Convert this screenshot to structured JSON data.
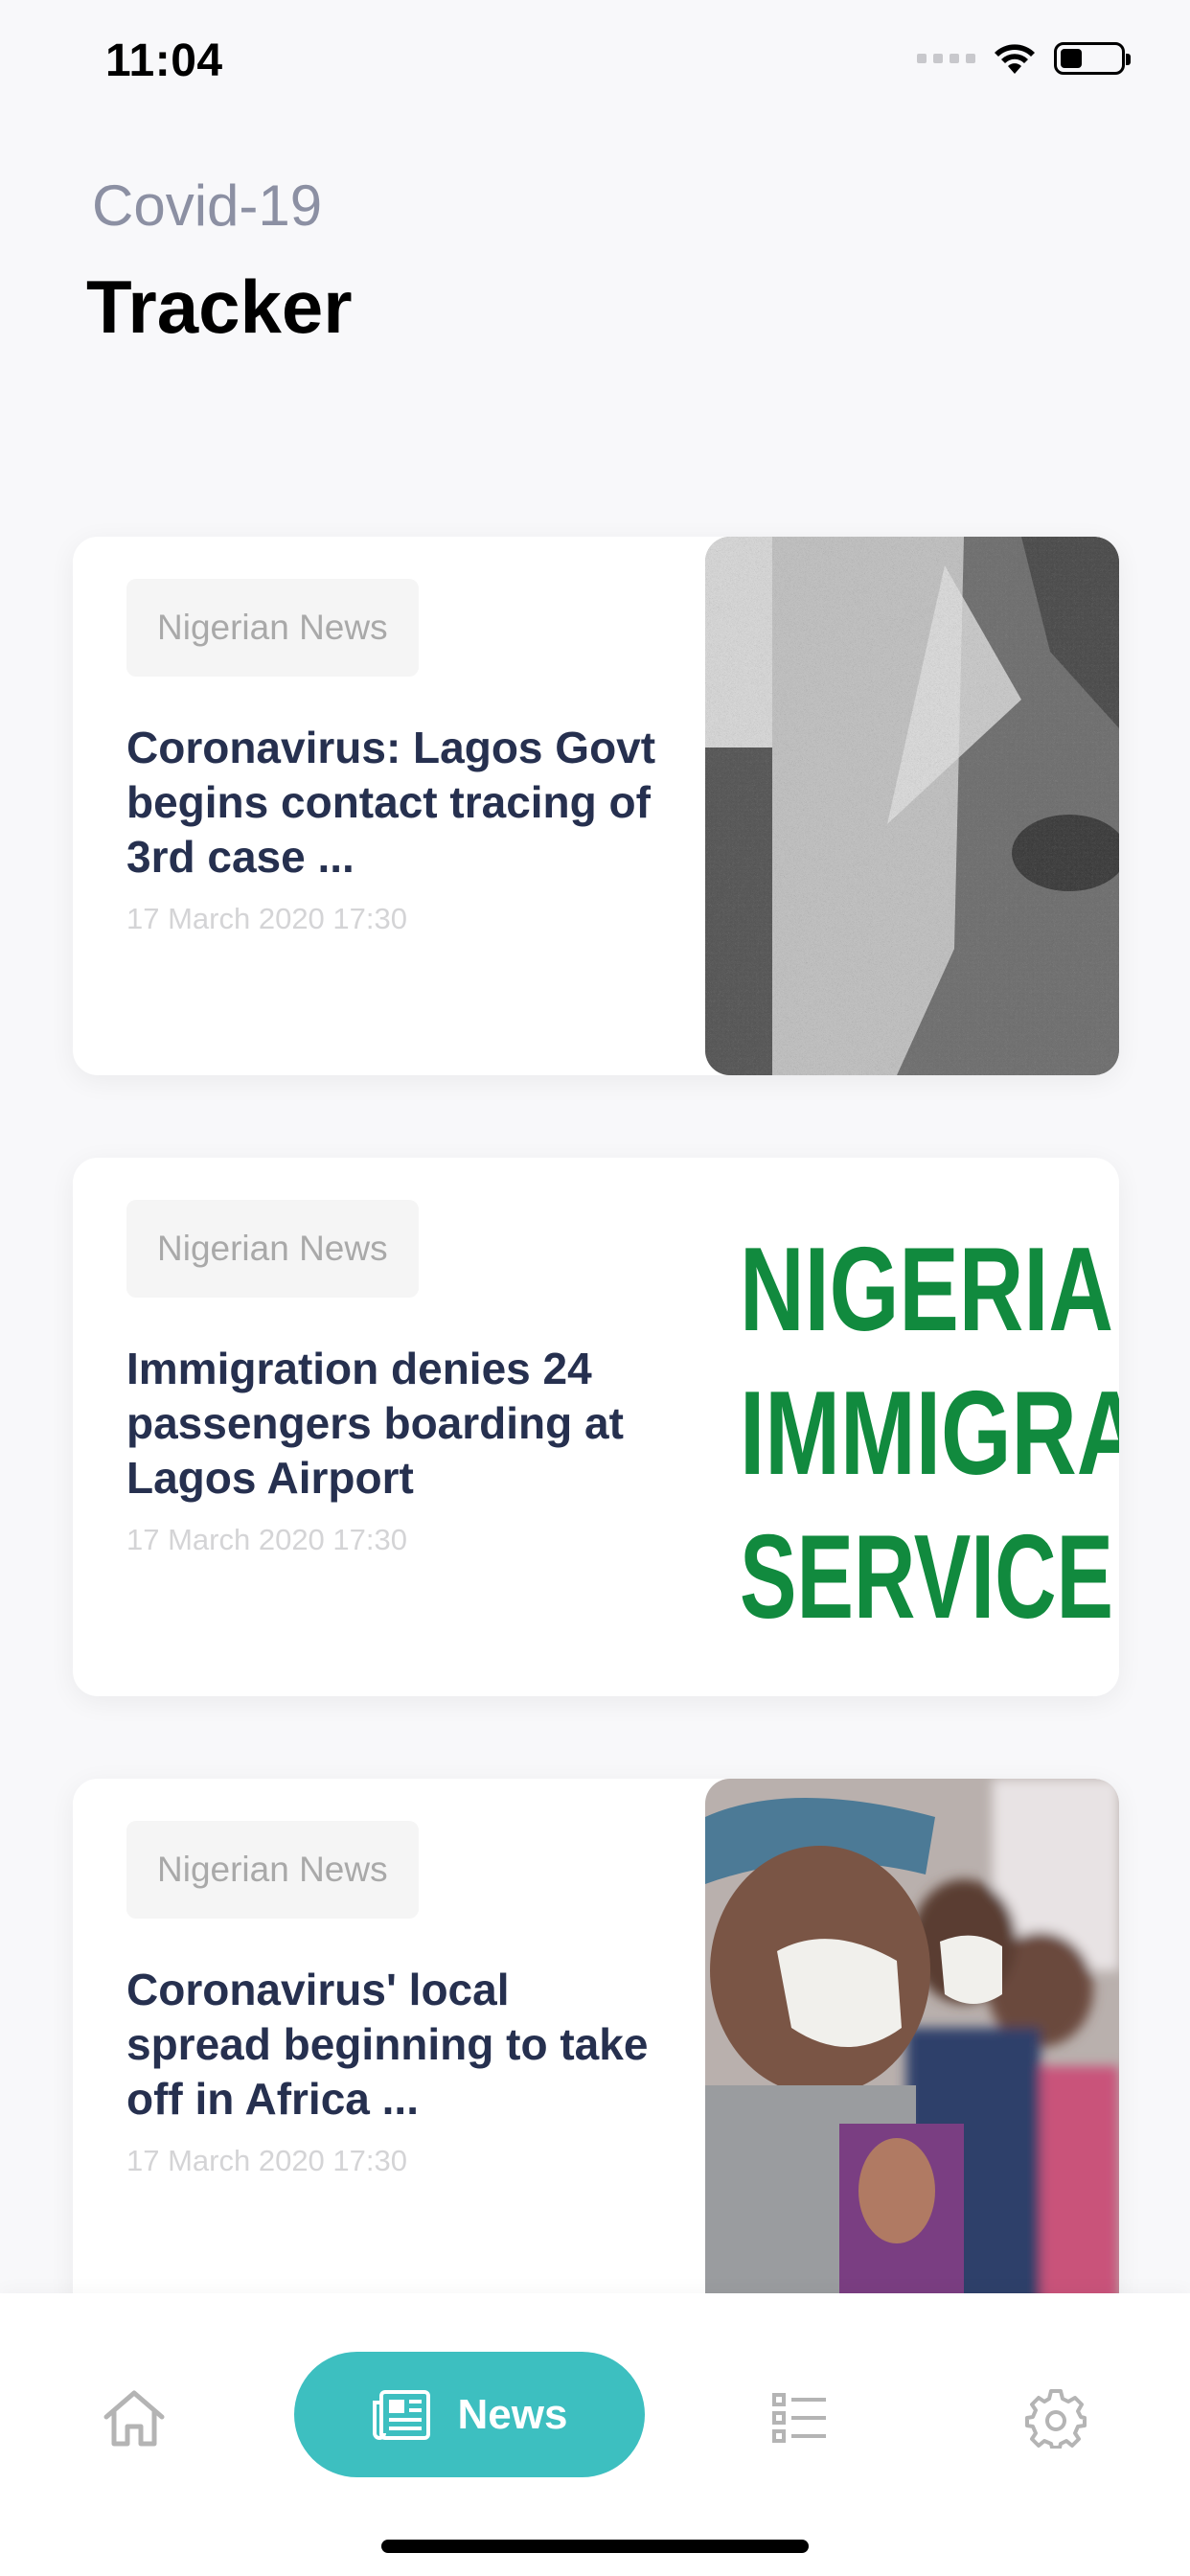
{
  "status_bar": {
    "time": "11:04"
  },
  "header": {
    "subtitle": "Covid-19",
    "title": "Tracker"
  },
  "articles": [
    {
      "category": "Nigerian News",
      "headline": "Coronavirus: Lagos Govt begins contact tracing of 3rd case ...",
      "date": "17 March 2020 17:30",
      "image_icon": "news-photo-grayscale"
    },
    {
      "category": "Nigerian News",
      "headline": "Immigration denies 24 passengers boarding at Lagos Airport",
      "date": "17 March 2020 17:30",
      "image_text": [
        "NIGERIA",
        "IMMIGRA",
        "SERVICE"
      ]
    },
    {
      "category": "Nigerian News",
      "headline": "Coronavirus' local spread beginning to take off in Africa ...",
      "date": "17 March 2020 17:30",
      "image_icon": "children-masks-photo"
    }
  ],
  "bottom_nav": {
    "active_label": "News",
    "items": [
      "home-icon",
      "news-icon",
      "list-icon",
      "gear-icon"
    ],
    "accent_color": "#3dbfc0"
  }
}
